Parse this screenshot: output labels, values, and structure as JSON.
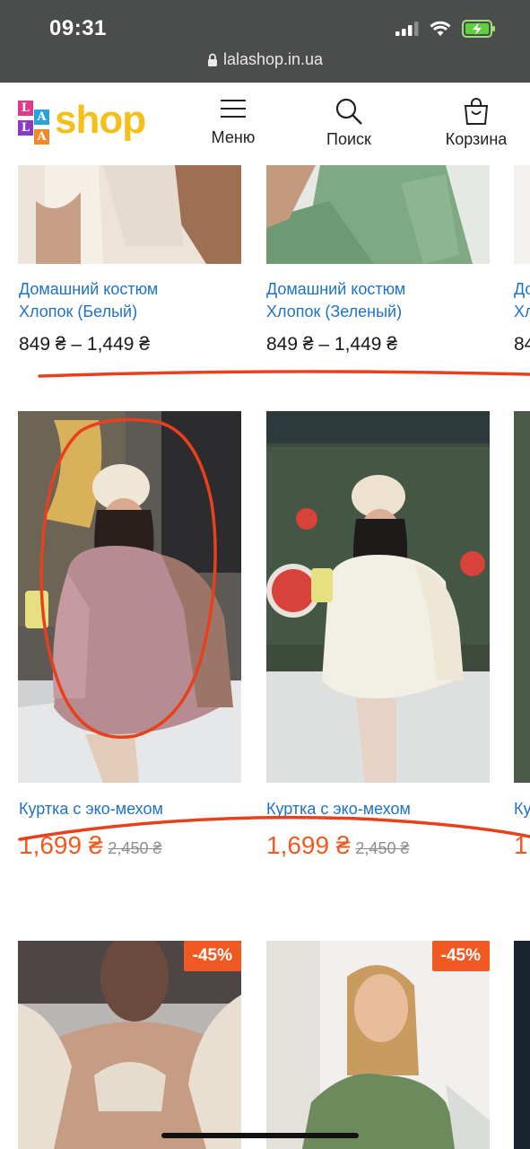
{
  "status": {
    "time": "09:31"
  },
  "browser": {
    "url": "lalashop.in.ua"
  },
  "logo": {
    "letters": [
      "L",
      "A",
      "L",
      "A"
    ],
    "word": "shop"
  },
  "nav": {
    "menu": "Меню",
    "search": "Поиск",
    "cart": "Корзина"
  },
  "products_row1": [
    {
      "title_line1": "Домашний костюм",
      "title_line2": "Хлопок (Белый)",
      "price": "849 ₴ –  1,449 ₴"
    },
    {
      "title_line1": "Домашний костюм",
      "title_line2": "Хлопок (Зеленый)",
      "price": "849 ₴ –  1,449 ₴"
    },
    {
      "title_line1": "До",
      "title_line2": "Хл",
      "price": "84"
    }
  ],
  "products_row2": [
    {
      "title": "Куртка с эко-мехом",
      "sale_price": "1,699 ₴",
      "old_price": "2,450 ₴"
    },
    {
      "title": "Куртка с эко-мехом",
      "sale_price": "1,699 ₴",
      "old_price": "2,450 ₴"
    },
    {
      "title": "Ку",
      "sale_price": "1,"
    }
  ],
  "products_row3": [
    {
      "badge": "-45%"
    },
    {
      "badge": "-45%"
    }
  ],
  "colors": {
    "link": "#1f73c6",
    "accent": "#f05a22",
    "logo_yellow": "#f5bf1a",
    "annotation": "#e8401c"
  }
}
